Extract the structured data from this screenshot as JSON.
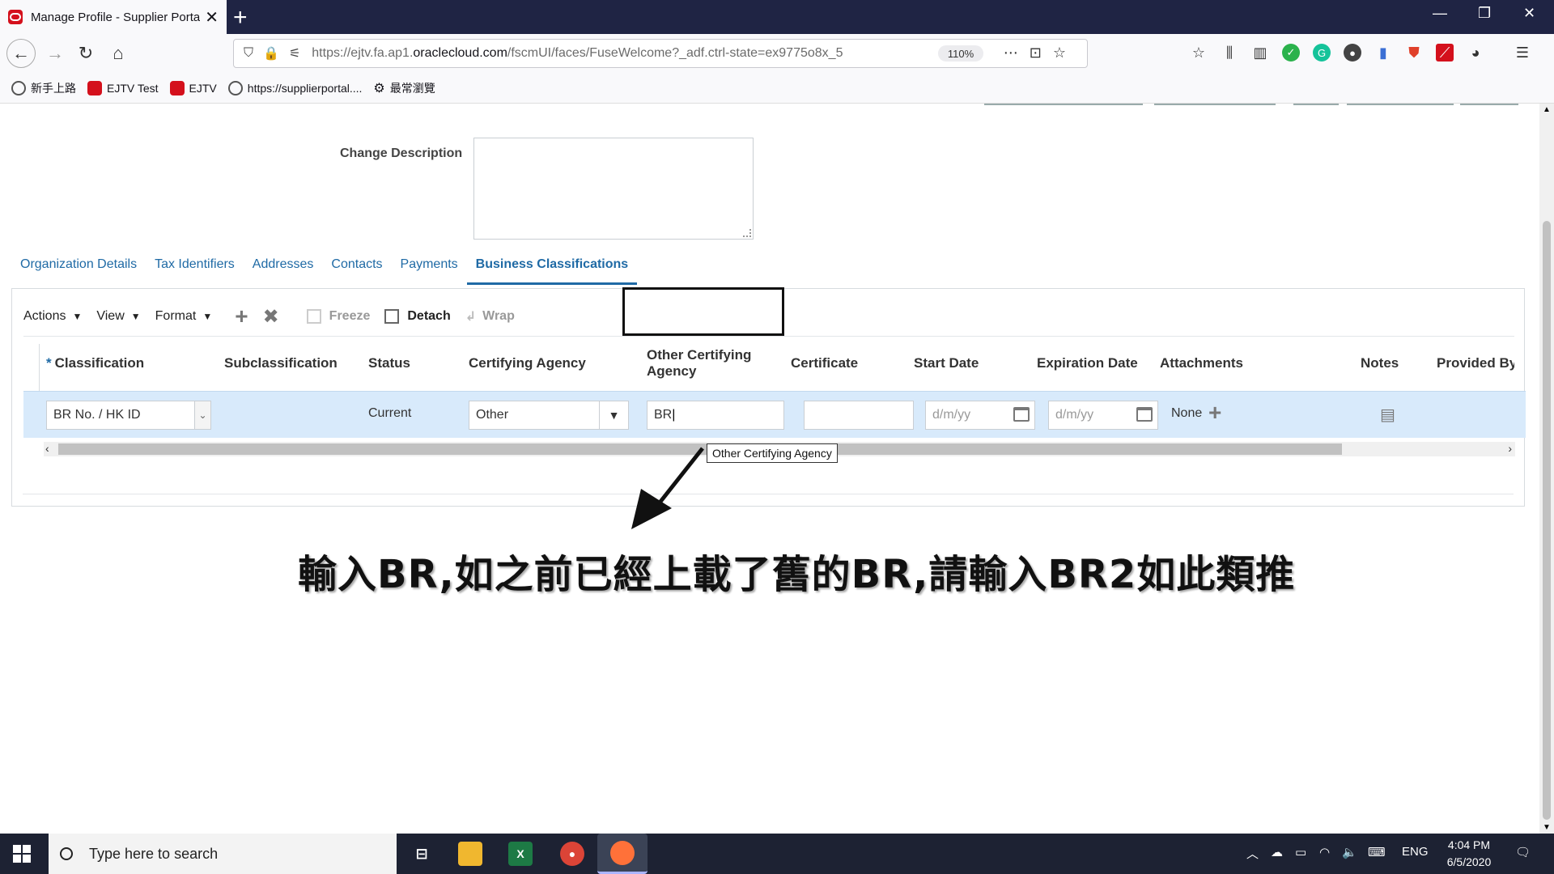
{
  "browser": {
    "tab_title": "Manage Profile - Supplier Porta",
    "url_prefix": "https://ejtv.fa.ap1.",
    "url_domain": "oraclecloud.com",
    "url_path": "/fscmUI/faces/FuseWelcome?_adf.ctrl-state=ex9775o8x_5",
    "zoom": "110%",
    "bookmarks": [
      {
        "label": "新手上路"
      },
      {
        "label": "EJTV Test"
      },
      {
        "label": "EJTV"
      },
      {
        "label": "https://supplierportal...."
      },
      {
        "label": "最常瀏覽"
      }
    ]
  },
  "form": {
    "change_description_label": "Change Description",
    "change_description_value": ""
  },
  "tabs": [
    {
      "label": "Organization Details"
    },
    {
      "label": "Tax Identifiers"
    },
    {
      "label": "Addresses"
    },
    {
      "label": "Contacts"
    },
    {
      "label": "Payments"
    },
    {
      "label": "Business Classifications",
      "active": true
    }
  ],
  "toolbar": {
    "actions": "Actions",
    "view": "View",
    "format": "Format",
    "freeze": "Freeze",
    "detach": "Detach",
    "wrap": "Wrap"
  },
  "table": {
    "headers": {
      "classification": "Classification",
      "subclassification": "Subclassification",
      "status": "Status",
      "certifying_agency": "Certifying Agency",
      "other_certifying_agency_1": "Other Certifying",
      "other_certifying_agency_2": "Agency",
      "certificate": "Certificate",
      "start_date": "Start Date",
      "expiration_date": "Expiration Date",
      "attachments": "Attachments",
      "notes": "Notes",
      "provided_by": "Provided By"
    },
    "row": {
      "classification": "BR No. / HK ID",
      "status": "Current",
      "certifying_agency": "Other",
      "other_certifying_agency": "BR",
      "certificate": "",
      "start_date_placeholder": "d/m/yy",
      "expiration_date_placeholder": "d/m/yy",
      "attachments": "None"
    }
  },
  "tooltip": "Other Certifying Agency",
  "caption": "輸入BR,如之前已經上載了舊的BR,請輸入BR2如此類推",
  "taskbar": {
    "search_placeholder": "Type here to search",
    "lang": "ENG",
    "time": "4:04 PM",
    "date": "6/5/2020"
  }
}
